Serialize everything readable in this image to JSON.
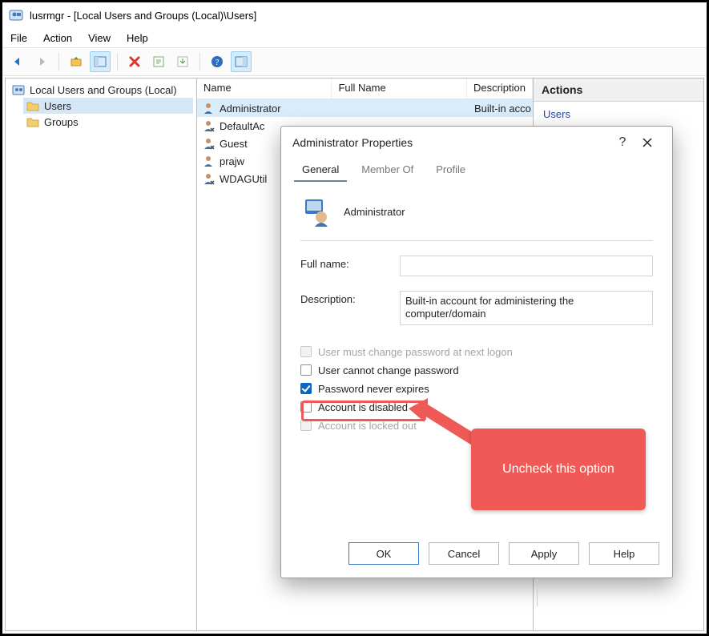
{
  "window": {
    "title": "lusrmgr - [Local Users and Groups (Local)\\Users]"
  },
  "menu": {
    "items": [
      "File",
      "Action",
      "View",
      "Help"
    ]
  },
  "toolbar": {
    "icons": [
      "back-icon",
      "forward-icon",
      "up-icon",
      "show-tree-icon",
      "delete-icon",
      "help-context-icon",
      "properties-icon",
      "help-icon",
      "show-action-pane-icon"
    ]
  },
  "tree": {
    "root": "Local Users and Groups (Local)",
    "children": [
      "Users",
      "Groups"
    ],
    "selected_index": 0
  },
  "list": {
    "columns": [
      "Name",
      "Full Name",
      "Description"
    ],
    "rows": [
      {
        "name": "Administrator",
        "full_name": "",
        "description": "Built-in acco",
        "selected": true
      },
      {
        "name": "DefaultAc",
        "full_name": "",
        "description": ""
      },
      {
        "name": "Guest",
        "full_name": "",
        "description": ""
      },
      {
        "name": "prajw",
        "full_name": "",
        "description": ""
      },
      {
        "name": "WDAGUtil",
        "full_name": "",
        "description": ""
      }
    ]
  },
  "actions": {
    "header": "Actions",
    "items": [
      "Users"
    ]
  },
  "dialog": {
    "title": "Administrator Properties",
    "help_symbol": "?",
    "close_symbol": "✕",
    "tabs": [
      "General",
      "Member Of",
      "Profile"
    ],
    "active_tab_index": 0,
    "account_name": "Administrator",
    "fields": {
      "full_name_label": "Full name:",
      "full_name_value": "",
      "description_label": "Description:",
      "description_value": "Built-in account for administering the computer/domain"
    },
    "checkboxes": [
      {
        "label": "User must change password at next logon",
        "checked": false,
        "enabled": false
      },
      {
        "label": "User cannot change password",
        "checked": false,
        "enabled": true
      },
      {
        "label": "Password never expires",
        "checked": true,
        "enabled": true
      },
      {
        "label": "Account is disabled",
        "checked": false,
        "enabled": true
      },
      {
        "label": "Account is locked out",
        "checked": false,
        "enabled": false
      }
    ],
    "buttons": {
      "ok": "OK",
      "cancel": "Cancel",
      "apply": "Apply",
      "help": "Help"
    }
  },
  "callout": {
    "text": "Uncheck this option"
  }
}
